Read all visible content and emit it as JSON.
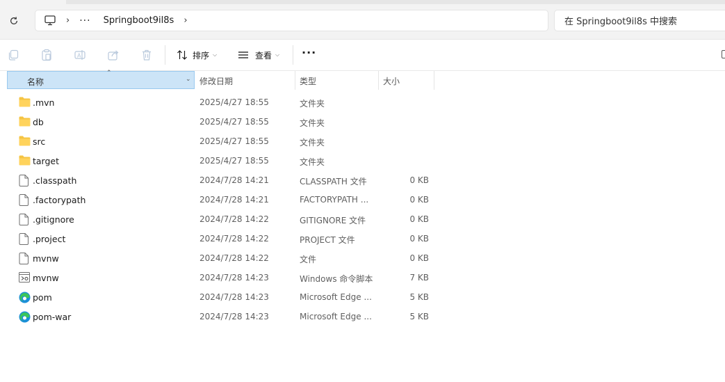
{
  "address": {
    "breadcrumb": "Springboot9il8s",
    "ellipsis": "···"
  },
  "search": {
    "placeholder": "在 Springboot9il8s 中搜索"
  },
  "toolbar": {
    "sort_label": "排序",
    "view_label": "查看",
    "more_label": "···"
  },
  "columns": {
    "name": "名称",
    "date": "修改日期",
    "type": "类型",
    "size": "大小"
  },
  "files": [
    {
      "name": ".mvn",
      "date": "2025/4/27 18:55",
      "type": "文件夹",
      "size": "",
      "icon": "folder-icon"
    },
    {
      "name": "db",
      "date": "2025/4/27 18:55",
      "type": "文件夹",
      "size": "",
      "icon": "folder-icon"
    },
    {
      "name": "src",
      "date": "2025/4/27 18:55",
      "type": "文件夹",
      "size": "",
      "icon": "folder-icon"
    },
    {
      "name": "target",
      "date": "2025/4/27 18:55",
      "type": "文件夹",
      "size": "",
      "icon": "folder-icon"
    },
    {
      "name": ".classpath",
      "date": "2024/7/28 14:21",
      "type": "CLASSPATH 文件",
      "size": "0 KB",
      "icon": "file-icon"
    },
    {
      "name": ".factorypath",
      "date": "2024/7/28 14:21",
      "type": "FACTORYPATH ...",
      "size": "0 KB",
      "icon": "file-icon"
    },
    {
      "name": ".gitignore",
      "date": "2024/7/28 14:22",
      "type": "GITIGNORE 文件",
      "size": "0 KB",
      "icon": "file-icon"
    },
    {
      "name": ".project",
      "date": "2024/7/28 14:22",
      "type": "PROJECT 文件",
      "size": "0 KB",
      "icon": "file-icon"
    },
    {
      "name": "mvnw",
      "date": "2024/7/28 14:22",
      "type": "文件",
      "size": "0 KB",
      "icon": "file-icon"
    },
    {
      "name": "mvnw",
      "date": "2024/7/28 14:23",
      "type": "Windows 命令脚本",
      "size": "7 KB",
      "icon": "script-icon"
    },
    {
      "name": "pom",
      "date": "2024/7/28 14:23",
      "type": "Microsoft Edge ...",
      "size": "5 KB",
      "icon": "edge-icon"
    },
    {
      "name": "pom-war",
      "date": "2024/7/28 14:23",
      "type": "Microsoft Edge ...",
      "size": "5 KB",
      "icon": "edge-icon"
    }
  ],
  "colors": {
    "selected_header_bg": "#cce4f7",
    "selected_header_border": "#99c9ef",
    "folder": "#f5c443"
  }
}
